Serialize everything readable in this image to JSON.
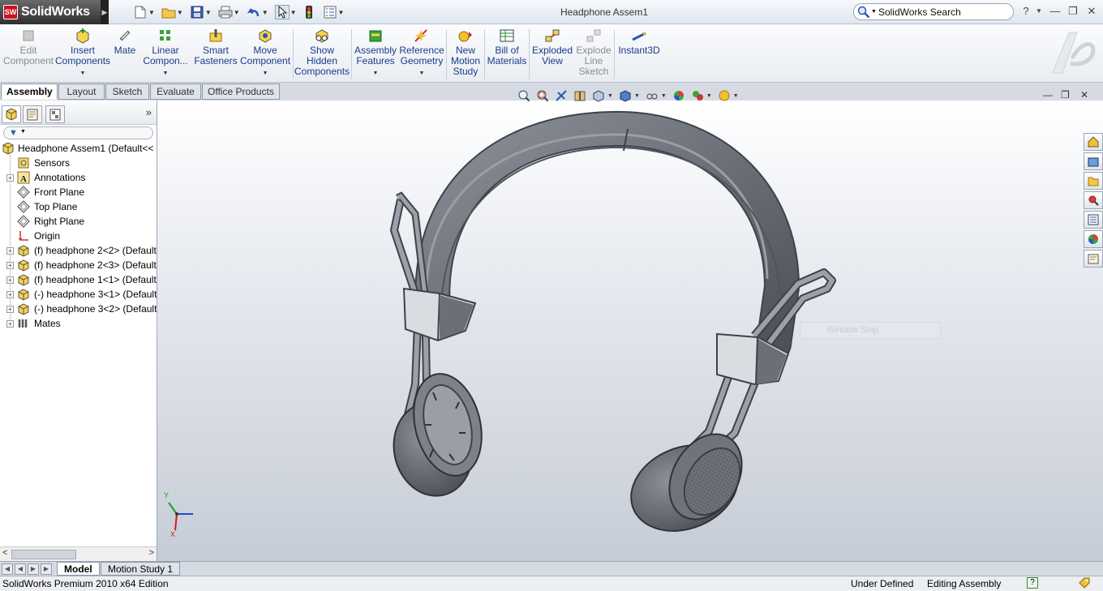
{
  "app": {
    "name": "SolidWorks",
    "logo_badge": "SW"
  },
  "window": {
    "title": "Headphone Assem1"
  },
  "search": {
    "placeholder": "SolidWorks Search",
    "help": "?"
  },
  "ribbon": {
    "buttons": [
      {
        "label": "Edit\nComponent",
        "icon": "edit-component-icon",
        "enabled": false
      },
      {
        "label": "Insert\nComponents",
        "icon": "insert-components-icon",
        "enabled": true,
        "dropdown": true
      },
      {
        "label": "Mate",
        "icon": "mate-icon",
        "enabled": true
      },
      {
        "label": "Linear\nCompon...",
        "icon": "linear-pattern-icon",
        "enabled": true,
        "dropdown": true
      },
      {
        "label": "Smart\nFasteners",
        "icon": "smart-fasteners-icon",
        "enabled": true
      },
      {
        "label": "Move\nComponent",
        "icon": "move-component-icon",
        "enabled": true,
        "dropdown": true
      },
      {
        "label": "Show\nHidden\nComponents",
        "icon": "show-hidden-icon",
        "enabled": true
      },
      {
        "label": "Assembly\nFeatures",
        "icon": "assembly-features-icon",
        "enabled": true,
        "dropdown": true
      },
      {
        "label": "Reference\nGeometry",
        "icon": "reference-geometry-icon",
        "enabled": true,
        "dropdown": true
      },
      {
        "label": "New\nMotion\nStudy",
        "icon": "motion-study-icon",
        "enabled": true
      },
      {
        "label": "Bill of\nMaterials",
        "icon": "bill-of-materials-icon",
        "enabled": true
      },
      {
        "label": "Exploded\nView",
        "icon": "exploded-view-icon",
        "enabled": true
      },
      {
        "label": "Explode\nLine\nSketch",
        "icon": "explode-line-sketch-icon",
        "enabled": false
      },
      {
        "label": "Instant3D",
        "icon": "instant3d-icon",
        "enabled": true
      }
    ]
  },
  "command_tabs": [
    "Assembly",
    "Layout",
    "Sketch",
    "Evaluate",
    "Office Products"
  ],
  "active_command_tab": "Assembly",
  "feature_tree": {
    "root": "Headphone Assem1  (Default<<",
    "items": [
      {
        "label": "Sensors",
        "icon": "sensors-icon",
        "expandable": false
      },
      {
        "label": "Annotations",
        "icon": "annotations-icon",
        "expandable": true
      },
      {
        "label": "Front Plane",
        "icon": "plane-icon",
        "expandable": false
      },
      {
        "label": "Top Plane",
        "icon": "plane-icon",
        "expandable": false
      },
      {
        "label": "Right Plane",
        "icon": "plane-icon",
        "expandable": false
      },
      {
        "label": "Origin",
        "icon": "origin-icon",
        "expandable": false
      },
      {
        "label": "(f) headphone 2<2> (Default",
        "icon": "part-icon",
        "expandable": true
      },
      {
        "label": "(f) headphone 2<3> (Default",
        "icon": "part-icon",
        "expandable": true
      },
      {
        "label": "(f) headphone 1<1> (Default",
        "icon": "part-icon",
        "expandable": true
      },
      {
        "label": "(-) headphone 3<1> (Default",
        "icon": "part-icon",
        "expandable": true
      },
      {
        "label": "(-) headphone 3<2> (Default",
        "icon": "part-icon",
        "expandable": true
      },
      {
        "label": "Mates",
        "icon": "mates-icon",
        "expandable": true
      }
    ]
  },
  "viewport": {
    "snip_overlay": "Window Snip",
    "triad": {
      "x": "X",
      "y": "Y"
    }
  },
  "bottom_tabs": [
    "Model",
    "Motion Study 1"
  ],
  "active_bottom_tab": "Model",
  "status": {
    "edition": "SolidWorks Premium 2010 x64 Edition",
    "state": "Under Defined",
    "mode": "Editing Assembly"
  },
  "colors": {
    "accent": "#1a3a8a",
    "part_gray": "#6b6f78",
    "logo_red": "#c8161d"
  }
}
